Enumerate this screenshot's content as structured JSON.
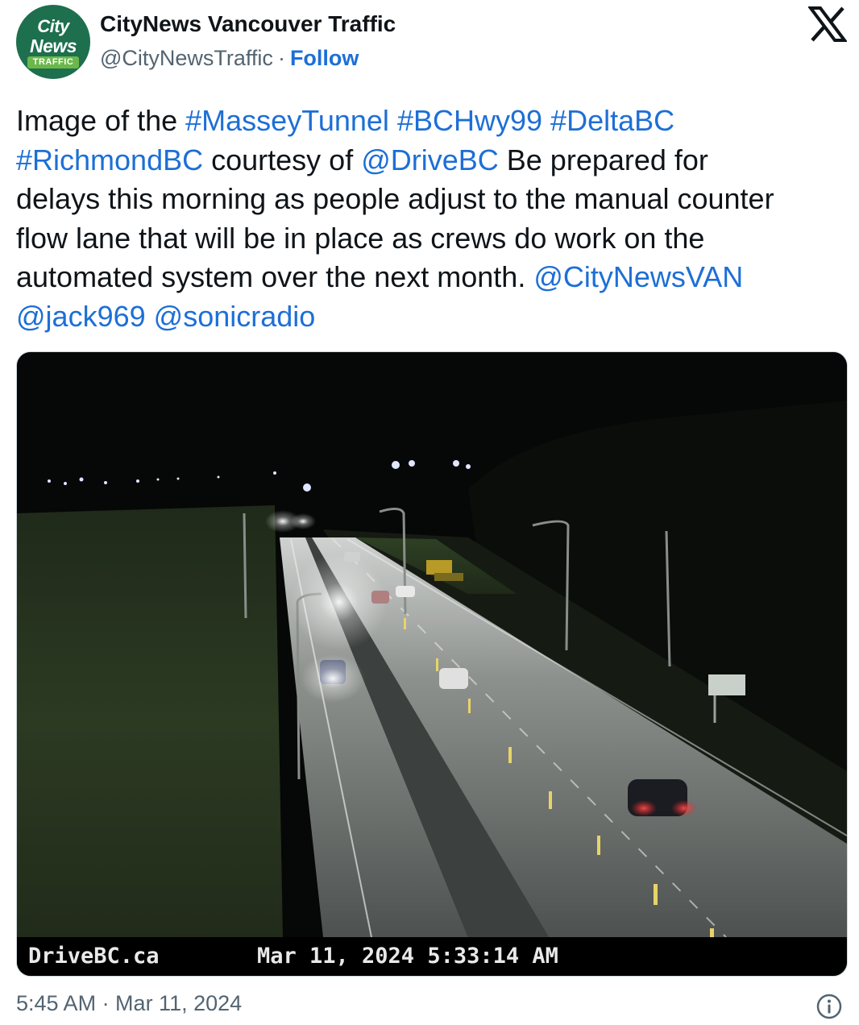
{
  "account": {
    "avatar_line1": "City",
    "avatar_line2": "News",
    "avatar_line3": "TRAFFIC",
    "display_name": "CityNews Vancouver Traffic",
    "handle": "@CityNewsTraffic",
    "separator": "·",
    "follow_label": "Follow",
    "logo_icon": "x-logo-icon"
  },
  "tweet": {
    "lines": [
      [
        {
          "t": "Image of the ",
          "k": "text"
        },
        {
          "t": "#MasseyTunnel",
          "k": "link"
        },
        {
          "t": " ",
          "k": "text"
        },
        {
          "t": "#BCHwy99",
          "k": "link"
        },
        {
          "t": " ",
          "k": "text"
        },
        {
          "t": "#DeltaBC",
          "k": "link"
        }
      ],
      [
        {
          "t": "#RichmondBC",
          "k": "link"
        },
        {
          "t": " courtesy of ",
          "k": "text"
        },
        {
          "t": "@DriveBC",
          "k": "link"
        },
        {
          "t": " Be prepared for",
          "k": "text"
        }
      ],
      [
        {
          "t": "delays this morning as people adjust to the manual counter",
          "k": "text"
        }
      ],
      [
        {
          "t": "flow lane that will be in place as crews do work on the",
          "k": "text"
        }
      ],
      [
        {
          "t": "automated system over the next month. ",
          "k": "text"
        },
        {
          "t": "@CityNewsVAN",
          "k": "link"
        }
      ],
      [
        {
          "t": "@jack969",
          "k": "link"
        },
        {
          "t": " ",
          "k": "text"
        },
        {
          "t": "@sonicradio",
          "k": "link"
        }
      ]
    ]
  },
  "media": {
    "camera_source": "DriveBC.ca",
    "camera_timestamp": "Mar 11, 2024 5:33:14 AM"
  },
  "footer": {
    "posted_time": "5:45 AM · Mar 11, 2024",
    "info_icon": "info-icon"
  },
  "colors": {
    "link": "#1d6fd6",
    "muted": "#536471",
    "avatar_bg": "#1d6f4e"
  }
}
